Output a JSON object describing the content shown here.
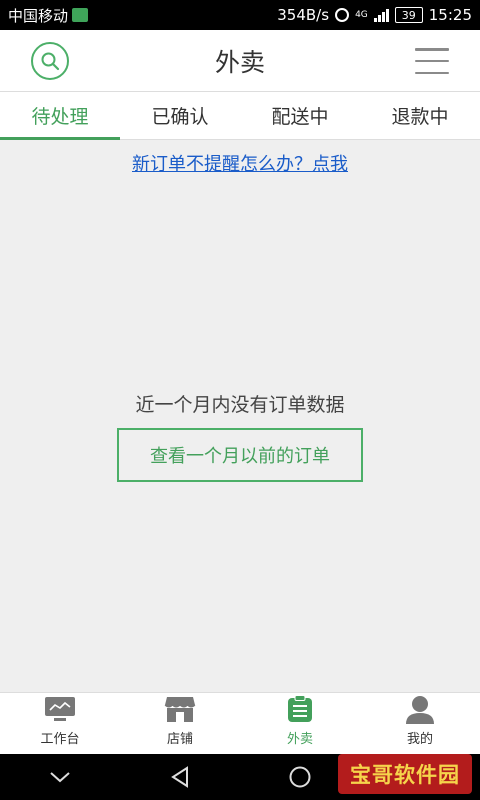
{
  "status_bar": {
    "carrier": "中国移动",
    "net_speed": "354B/s",
    "network_type": "4G",
    "battery": "39",
    "time": "15:25"
  },
  "header": {
    "title": "外卖",
    "search_icon": "search-icon",
    "menu_icon": "hamburger-menu-icon"
  },
  "tabs": [
    {
      "label": "待处理",
      "active": true
    },
    {
      "label": "已确认",
      "active": false
    },
    {
      "label": "配送中",
      "active": false
    },
    {
      "label": "退款中",
      "active": false
    }
  ],
  "content": {
    "reminder_link": "新订单不提醒怎么办？点我",
    "empty_text": "近一个月内没有订单数据",
    "older_orders_button": "查看一个月以前的订单"
  },
  "bottom_nav": [
    {
      "label": "工作台",
      "icon": "workbench-icon",
      "active": false
    },
    {
      "label": "店铺",
      "icon": "store-icon",
      "active": false
    },
    {
      "label": "外卖",
      "icon": "takeout-clipboard-icon",
      "active": true
    },
    {
      "label": "我的",
      "icon": "profile-icon",
      "active": false
    }
  ],
  "colors": {
    "accent": "#43a05b",
    "link": "#1a5cc9",
    "background": "#efefef"
  },
  "watermark": {
    "text": "宝哥软件园"
  }
}
